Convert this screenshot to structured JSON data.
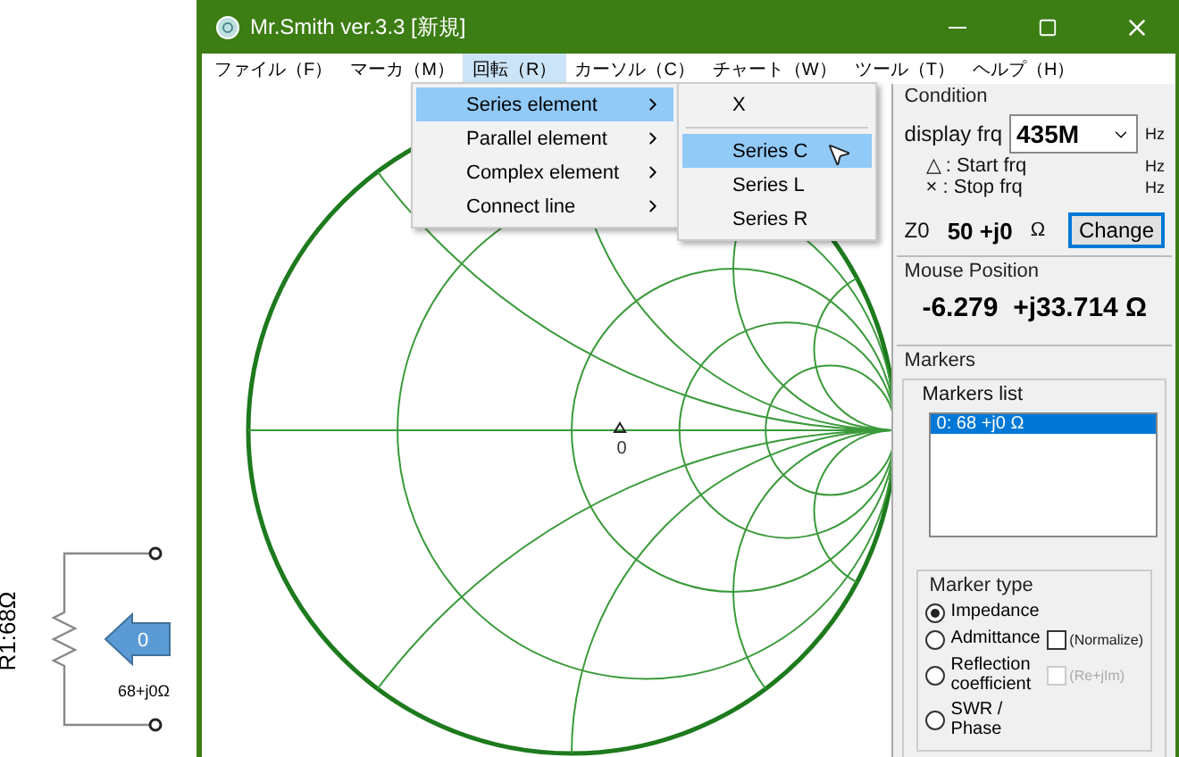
{
  "window": {
    "title": "Mr.Smith ver.3.3 [新規]"
  },
  "menu_bar": [
    {
      "label": "ファイル（F）",
      "selected": false
    },
    {
      "label": "マーカ（M）",
      "selected": false
    },
    {
      "label": "回転（R）",
      "selected": true
    },
    {
      "label": "カーソル（C）",
      "selected": false
    },
    {
      "label": "チャート（W）",
      "selected": false
    },
    {
      "label": "ツール（T）",
      "selected": false
    },
    {
      "label": "ヘルプ（H）",
      "selected": false
    }
  ],
  "menu": {
    "items": [
      {
        "label": "Series element",
        "selected": true
      },
      {
        "label": "Parallel element",
        "selected": false
      },
      {
        "label": "Complex element",
        "selected": false
      },
      {
        "label": "Connect line",
        "selected": false
      }
    ]
  },
  "submenu": {
    "items": [
      {
        "label": "X",
        "selected": false,
        "separator_after": true
      },
      {
        "label": "Series C",
        "selected": true,
        "separator_after": false
      },
      {
        "label": "Series L",
        "selected": false,
        "separator_after": false
      },
      {
        "label": "Series R",
        "selected": false,
        "separator_after": false
      }
    ]
  },
  "chart": {
    "marker_label": "0"
  },
  "condition": {
    "title": "Condition",
    "display_frq_label": "display frq",
    "display_frq_value": "435M",
    "display_frq_unit": "Hz",
    "start_label": "△ : Start frq",
    "start_unit": "Hz",
    "stop_label": "× : Stop frq",
    "stop_unit": "Hz",
    "z0_label": "Z0",
    "z0_value": "50 +j0",
    "z0_unit": "Ω",
    "change_button": "Change"
  },
  "mouse_position": {
    "title": "Mouse Position",
    "value": "-6.279  +j33.714 Ω"
  },
  "markers": {
    "title": "Markers",
    "list_label": "Markers list",
    "items": [
      {
        "label": "0: 68 +j0 Ω",
        "selected": true
      }
    ]
  },
  "marker_type": {
    "title": "Marker type",
    "options": [
      {
        "label": "Impedance",
        "selected": true
      },
      {
        "label": "Admittance",
        "selected": false
      },
      {
        "label": "Reflection coefficient",
        "selected": false
      },
      {
        "label": "SWR / Phase",
        "selected": false
      }
    ],
    "checkboxes": [
      {
        "label": "(Normalize)",
        "checked": false,
        "disabled": false
      },
      {
        "label": "(Re+jIm)",
        "checked": false,
        "disabled": true
      }
    ]
  },
  "circuit": {
    "resistor_label": "R1:68Ω",
    "port_number": "0",
    "impedance": "68+j0Ω"
  }
}
